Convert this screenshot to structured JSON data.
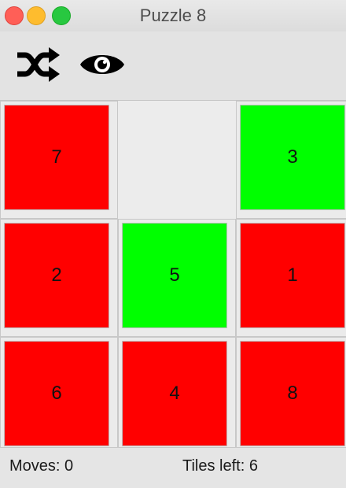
{
  "window": {
    "title": "Puzzle 8"
  },
  "toolbar": {
    "shuffle_icon": "shuffle-icon",
    "reveal_icon": "eye-icon"
  },
  "board": {
    "rows": [
      [
        {
          "label": "7",
          "state": "red"
        },
        {
          "label": "",
          "state": "empty"
        },
        {
          "label": "3",
          "state": "green"
        }
      ],
      [
        {
          "label": "2",
          "state": "red"
        },
        {
          "label": "5",
          "state": "green"
        },
        {
          "label": "1",
          "state": "red"
        }
      ],
      [
        {
          "label": "6",
          "state": "red"
        },
        {
          "label": "4",
          "state": "red"
        },
        {
          "label": "8",
          "state": "red"
        }
      ]
    ],
    "colors": {
      "red": "#ff0000",
      "green": "#00ff00"
    }
  },
  "status": {
    "moves_text": "Moves: 0",
    "tiles_left_text": "Tiles left: 6"
  }
}
